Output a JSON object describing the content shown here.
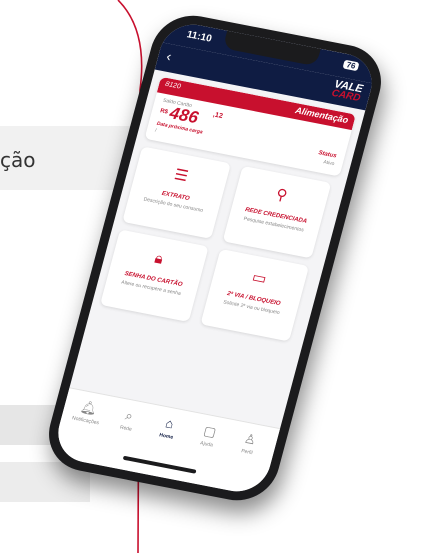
{
  "background": {
    "partial_text": "ção",
    "accent_color": "#c8102e"
  },
  "app": {
    "status_time": "11:10",
    "battery": "76",
    "logo_line1": "VALE",
    "logo_line2": "CARD",
    "card": {
      "number": "8120",
      "type": "Alimentação",
      "balance_label": "Saldo Cartão",
      "currency": "R$",
      "amount": "486",
      "cents": ",12",
      "next_charge_label": "Data próxima carga",
      "next_charge_value": "/",
      "status_label": "Status",
      "status_value": "Ativo"
    },
    "tiles": [
      {
        "icon": "list-icon",
        "title": "EXTRATO",
        "subtitle": "Descrição do seu consumo"
      },
      {
        "icon": "location-pin-icon",
        "title": "REDE CREDENCIADA",
        "subtitle": "Pesquise estabelecimentos"
      },
      {
        "icon": "lock-icon",
        "title": "SENHA DO CARTÃO",
        "subtitle": "Altere ou recupere a senha"
      },
      {
        "icon": "credit-card-icon",
        "title": "2ª VIA / BLOQUEIO",
        "subtitle": "Solicite 2ª via ou bloqueio"
      }
    ],
    "tabs": [
      {
        "icon": "bell-icon",
        "label": "Notificações"
      },
      {
        "icon": "search-icon",
        "label": "Rede"
      },
      {
        "icon": "home-icon",
        "label": "Home"
      },
      {
        "icon": "chat-icon",
        "label": "Ajuda"
      },
      {
        "icon": "user-icon",
        "label": "Perfil"
      }
    ],
    "active_tab": "Home",
    "colors": {
      "primary": "#c8102e",
      "navy": "#0f1c43"
    }
  }
}
